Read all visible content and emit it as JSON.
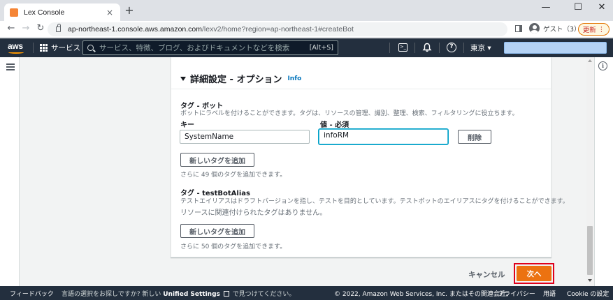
{
  "browser": {
    "tab_title": "Lex Console",
    "tab_close": "×",
    "new_tab": "+",
    "win_minimize": "—",
    "win_maximize": "☐",
    "win_close": "✕",
    "back": "←",
    "forward": "→",
    "reload": "↻",
    "url_host": "ap-northeast-1.console.aws.amazon.com",
    "url_path": "/lexv2/home?region=ap-northeast-1#createBot",
    "profile_label": "ゲスト（3）",
    "update_label": "更新",
    "update_dots": "⋮"
  },
  "aws_nav": {
    "logo": "aws",
    "services": "サービス",
    "search_placeholder": "サービス、特徴、ブログ、およびドキュメントなどを検索",
    "search_shortcut": "[Alt+S]",
    "cloudshell_glyph": ">_",
    "help_glyph": "?",
    "region": "東京 ▾"
  },
  "section": {
    "title": "詳細設定 - オプション",
    "info": "Info"
  },
  "bot_tags": {
    "heading": "タグ - ボット",
    "description": "ボットにラベルを付けることができます。タグは、リソースの管理、識別、整理、検索、フィルタリングに役立ちます。",
    "key_label": "キー",
    "value_label": "値 - 必須",
    "key_value": "SystemName",
    "value_value": "infoRM",
    "remove_button": "削除",
    "add_button": "新しいタグを追加",
    "remaining": "さらに 49 個のタグを追加できます。"
  },
  "alias_tags": {
    "heading": "タグ - testBotAlias",
    "description": "テストエイリアスはドラフトバージョンを指し、テストを目的としています。テストボットのエイリアスにタグを付けることができます。",
    "empty": "リソースに関連付けられたタグはありません。",
    "add_button": "新しいタグを追加",
    "remaining": "さらに 50 個のタグを追加できます。"
  },
  "actions": {
    "cancel": "キャンセル",
    "next": "次へ"
  },
  "footer": {
    "feedback": "フィードバック",
    "language_prompt": "言語の選択をお探しですか? 新しい",
    "unified_settings": "Unified Settings",
    "language_suffix": "で見つけてください。",
    "copyright": "© 2022, Amazon Web Services, Inc. またはその関連会社。",
    "privacy": "プライバシー",
    "terms": "用語",
    "cookie": "Cookie の設定"
  },
  "colors": {
    "aws_nav": "#232f3e",
    "primary": "#ec7211",
    "highlight": "#e0001b",
    "link": "#0073bb",
    "focus": "#00a1c9"
  },
  "icons": [
    "favicon-icon",
    "lock-icon",
    "grid-icon",
    "search-icon",
    "cloudshell-icon",
    "bell-icon",
    "help-icon",
    "hamburger-icon",
    "info-icon",
    "external-link-icon"
  ]
}
